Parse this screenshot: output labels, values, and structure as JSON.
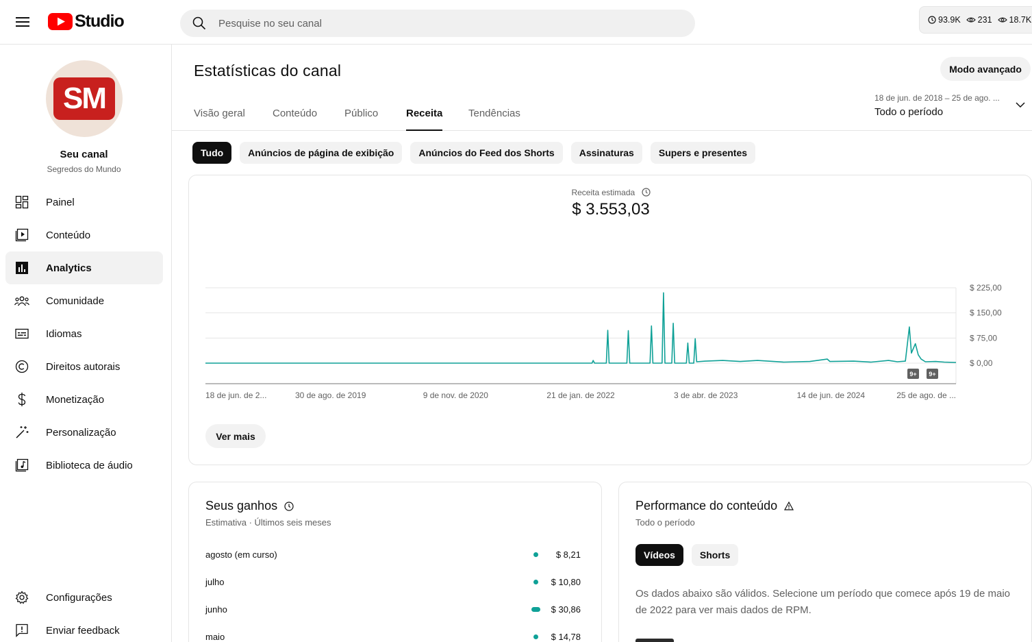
{
  "header": {
    "logo_text": "Studio",
    "search_placeholder": "Pesquise no seu canal",
    "stats": [
      {
        "icon": "clock-icon",
        "value": "93.9K"
      },
      {
        "icon": "eye-icon",
        "value": "231"
      },
      {
        "icon": "eye-icon",
        "value": "18.7K"
      }
    ]
  },
  "sidebar": {
    "avatar_text": "SM",
    "channel_name": "Seu canal",
    "channel_sub": "Segredos do Mundo",
    "items": [
      {
        "label": "Painel",
        "icon": "dashboard-icon"
      },
      {
        "label": "Conteúdo",
        "icon": "content-icon"
      },
      {
        "label": "Analytics",
        "icon": "analytics-icon",
        "active": true
      },
      {
        "label": "Comunidade",
        "icon": "community-icon"
      },
      {
        "label": "Idiomas",
        "icon": "subtitles-icon"
      },
      {
        "label": "Direitos autorais",
        "icon": "copyright-icon"
      },
      {
        "label": "Monetização",
        "icon": "dollar-icon"
      },
      {
        "label": "Personalização",
        "icon": "magic-wand-icon"
      },
      {
        "label": "Biblioteca de áudio",
        "icon": "audio-library-icon"
      }
    ],
    "bottom_items": [
      {
        "label": "Configurações",
        "icon": "gear-icon"
      },
      {
        "label": "Enviar feedback",
        "icon": "feedback-icon"
      }
    ]
  },
  "main": {
    "title": "Estatísticas do canal",
    "advanced_button": "Modo avançado",
    "tabs": [
      "Visão geral",
      "Conteúdo",
      "Público",
      "Receita",
      "Tendências"
    ],
    "active_tab": "Receita",
    "date_range": {
      "range": "18 de jun. de 2018 – 25 de ago. ...",
      "label": "Todo o período"
    },
    "chips": [
      "Tudo",
      "Anúncios de página de exibição",
      "Anúncios do Feed dos Shorts",
      "Assinaturas",
      "Supers e presentes"
    ],
    "active_chip": "Tudo",
    "metric": {
      "label": "Receita estimada",
      "value": "$ 3.553,03"
    },
    "more_button": "Ver mais",
    "markers": [
      "9+",
      "9+"
    ]
  },
  "chart_data": {
    "type": "line",
    "ylim": [
      0,
      225
    ],
    "y_ticks": [
      "$ 225,00",
      "$ 150,00",
      "$ 75,00",
      "$ 0,00"
    ],
    "x_ticks": [
      "18 de jun. de 2...",
      "30 de ago. de 2019",
      "9 de nov. de 2020",
      "21 de jan. de 2022",
      "3 de abr. de 2023",
      "14 de jun. de 2024",
      "25 de ago. de ..."
    ],
    "x_range": [
      "2018-06-18",
      "2025-08-25"
    ],
    "series": [
      {
        "color": "#0fa197",
        "points": [
          [
            "2018-06-18",
            0
          ],
          [
            "2022-03-01",
            0
          ],
          [
            "2022-03-05",
            8
          ],
          [
            "2022-03-10",
            0
          ],
          [
            "2022-04-20",
            0
          ],
          [
            "2022-04-25",
            98
          ],
          [
            "2022-04-30",
            0
          ],
          [
            "2022-07-01",
            0
          ],
          [
            "2022-07-06",
            97
          ],
          [
            "2022-07-11",
            0
          ],
          [
            "2022-09-20",
            0
          ],
          [
            "2022-09-25",
            111
          ],
          [
            "2022-09-30",
            0
          ],
          [
            "2022-11-01",
            0
          ],
          [
            "2022-11-06",
            210
          ],
          [
            "2022-11-11",
            0
          ],
          [
            "2022-12-05",
            0
          ],
          [
            "2022-12-10",
            119
          ],
          [
            "2022-12-15",
            0
          ],
          [
            "2023-01-25",
            0
          ],
          [
            "2023-01-30",
            60
          ],
          [
            "2023-02-04",
            0
          ],
          [
            "2023-02-20",
            0
          ],
          [
            "2023-02-25",
            73
          ],
          [
            "2023-03-02",
            4
          ],
          [
            "2023-04-01",
            6
          ],
          [
            "2023-06-01",
            8
          ],
          [
            "2023-08-01",
            5
          ],
          [
            "2023-10-01",
            8
          ],
          [
            "2024-01-01",
            3
          ],
          [
            "2024-04-01",
            5
          ],
          [
            "2024-06-01",
            12
          ],
          [
            "2024-06-10",
            5
          ],
          [
            "2024-09-01",
            6
          ],
          [
            "2024-11-01",
            3
          ],
          [
            "2025-01-01",
            8
          ],
          [
            "2025-02-01",
            4
          ],
          [
            "2025-03-01",
            6
          ],
          [
            "2025-03-15",
            108
          ],
          [
            "2025-03-22",
            30
          ],
          [
            "2025-04-05",
            58
          ],
          [
            "2025-04-15",
            25
          ],
          [
            "2025-04-25",
            12
          ],
          [
            "2025-05-10",
            4
          ],
          [
            "2025-06-15",
            5
          ],
          [
            "2025-07-15",
            3
          ],
          [
            "2025-08-25",
            2
          ]
        ]
      }
    ]
  },
  "earnings": {
    "title": "Seus ganhos",
    "subtitle": "Estimativa · Últimos seis meses",
    "max": 30.86,
    "rows": [
      {
        "month": "agosto (em curso)",
        "value": 8.21,
        "value_text": "$ 8,21"
      },
      {
        "month": "julho",
        "value": 10.8,
        "value_text": "$ 10,80"
      },
      {
        "month": "junho",
        "value": 30.86,
        "value_text": "$ 30,86"
      },
      {
        "month": "maio",
        "value": 14.78,
        "value_text": "$ 14,78"
      }
    ]
  },
  "performance": {
    "title": "Performance do conteúdo",
    "subtitle": "Todo o período",
    "chips": [
      "Vídeos",
      "Shorts"
    ],
    "active_chip": "Vídeos",
    "note": "Os dados abaixo são válidos. Selecione um período que comece após 19 de maio de 2022 para ver mais dados de RPM."
  }
}
